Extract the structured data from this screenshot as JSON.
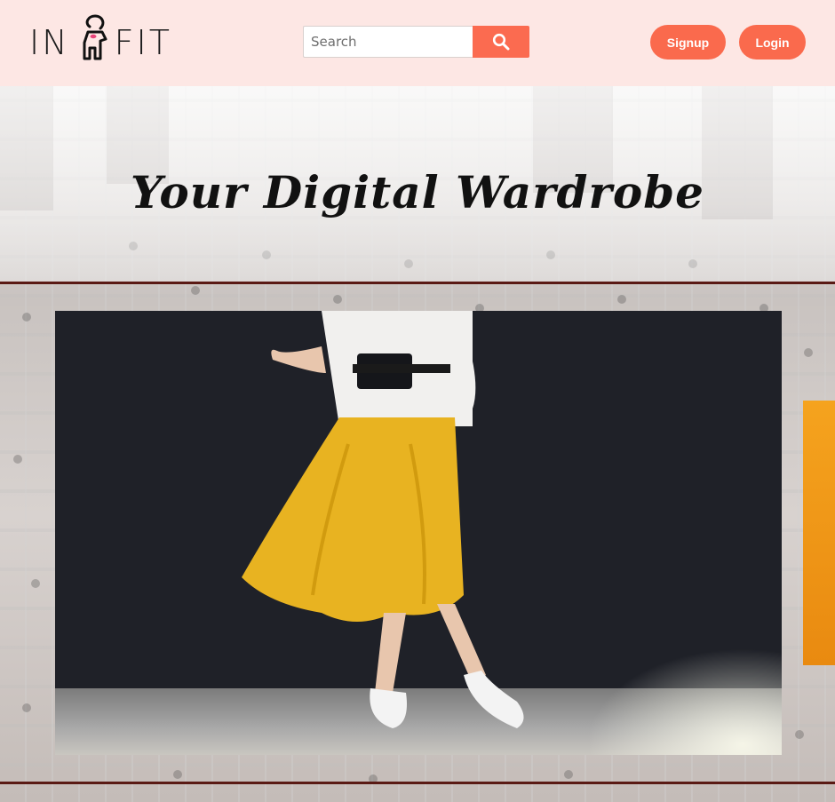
{
  "navbar": {
    "logo_left": "IN",
    "logo_right": "FIT",
    "search_placeholder": "Search",
    "search_icon": "search-icon",
    "signup_label": "Signup",
    "login_label": "Login"
  },
  "hero": {
    "title": "Your Digital Wardrobe"
  },
  "colors": {
    "accent": "#fa6a4d",
    "navbar_bg": "#fde7e4",
    "rule": "#5a1a14",
    "skirt": "#e8b321",
    "next_slide": "#f5a31e"
  }
}
